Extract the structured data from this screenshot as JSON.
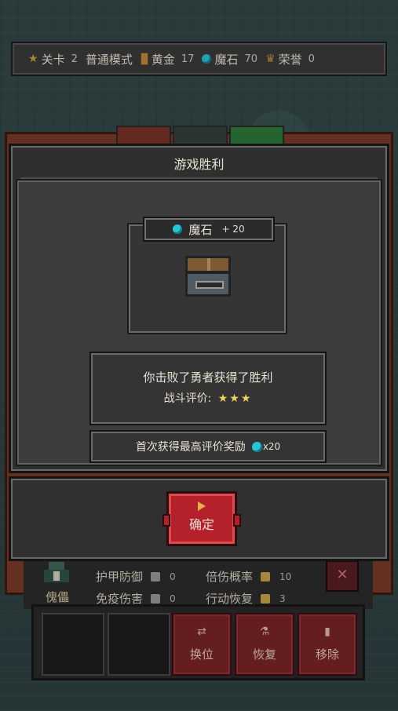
{
  "topbar": {
    "level_label": "关卡",
    "level_value": "2",
    "mode": "普通模式",
    "gold_label": "黄金",
    "gold_value": "17",
    "gem_label": "魔石",
    "gem_value": "70",
    "honor_label": "荣誉",
    "honor_value": "0"
  },
  "dialog": {
    "title": "游戏胜利",
    "reward_item": "魔石",
    "reward_amount": "+ 20",
    "result_line": "你击败了勇者获得了胜利",
    "rating_label": "战斗评价:",
    "rating_stars": "★★★",
    "bonus_text": "首次获得最高评价奖励",
    "bonus_amount": "x20",
    "confirm_label": "确定"
  },
  "hero": {
    "name": "傀儡",
    "stats": [
      {
        "label": "护甲防御",
        "value": "0"
      },
      {
        "label": "倍伤概率",
        "value": "10"
      },
      {
        "label": "免疫伤害",
        "value": "0"
      },
      {
        "label": "行动恢复",
        "value": "3"
      }
    ],
    "close_icon": "✕"
  },
  "actions": {
    "swap_label": "换位",
    "restore_label": "恢复",
    "remove_label": "移除"
  },
  "colors": {
    "gem": "#27c6d6",
    "confirm": "#b5212b",
    "stars": "#f0d35c",
    "action": "#7a2528"
  }
}
